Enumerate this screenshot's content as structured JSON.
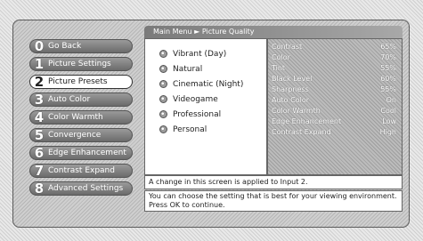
{
  "header": {
    "breadcrumb": "Main Menu ► Picture Quality"
  },
  "menu": {
    "items": [
      {
        "number": "0",
        "label": "Go Back"
      },
      {
        "number": "1",
        "label": "Picture Settings"
      },
      {
        "number": "2",
        "label": "Picture Presets",
        "selected": true
      },
      {
        "number": "3",
        "label": "Auto Color"
      },
      {
        "number": "4",
        "label": "Color Warmth"
      },
      {
        "number": "5",
        "label": "Convergence"
      },
      {
        "number": "6",
        "label": "Edge Enhancement"
      },
      {
        "number": "7",
        "label": "Contrast Expand"
      },
      {
        "number": "8",
        "label": "Advanced Settings"
      }
    ]
  },
  "presets": {
    "options": [
      {
        "label": "Vibrant (Day)",
        "icon": "radio-icon"
      },
      {
        "label": "Natural",
        "icon": "radio-icon"
      },
      {
        "label": "Cinematic (Night)",
        "icon": "radio-icon"
      },
      {
        "label": "Videogame",
        "icon": "radio-icon"
      },
      {
        "label": "Professional",
        "icon": "radio-icon"
      },
      {
        "label": "Personal",
        "icon": "radio-icon"
      }
    ]
  },
  "settings": {
    "rows": [
      {
        "name": "Contrast",
        "value": "65%"
      },
      {
        "name": "Color",
        "value": "70%"
      },
      {
        "name": "Tint",
        "value": "55%"
      },
      {
        "name": "Black Level",
        "value": "60%"
      },
      {
        "name": "Sharpness",
        "value": "55%"
      },
      {
        "name": "Auto Color",
        "value": "On"
      },
      {
        "name": "Color Warmth",
        "value": "Cool"
      },
      {
        "name": "Edge Enhancement",
        "value": "Low"
      },
      {
        "name": "Contrast Expand",
        "value": "High"
      }
    ]
  },
  "notice": {
    "text": "A change in this screen is applied to Input 2."
  },
  "help": {
    "text": "You can choose the setting that is best for your viewing environment. Press OK to continue."
  }
}
